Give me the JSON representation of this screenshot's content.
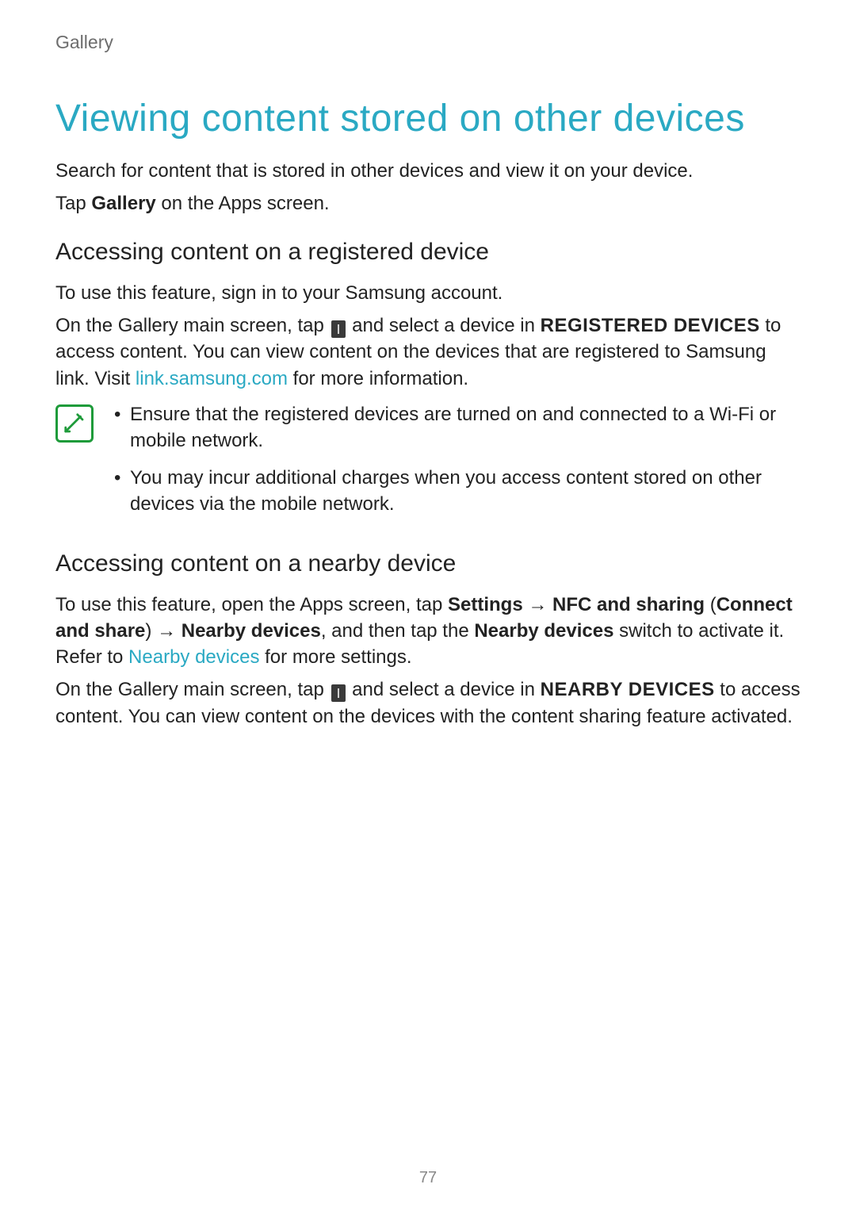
{
  "breadcrumb": "Gallery",
  "heading": "Viewing content stored on other devices",
  "intro1": "Search for content that is stored in other devices and view it on your device.",
  "intro2_pre": "Tap ",
  "intro2_bold": "Gallery",
  "intro2_post": " on the Apps screen.",
  "section1": {
    "heading": "Accessing content on a registered device",
    "p1": "To use this feature, sign in to your Samsung account.",
    "p2_a": "On the Gallery main screen, tap ",
    "p2_b": " and select a device in ",
    "p2_bold": "REGISTERED DEVICES",
    "p2_c": " to access content. You can view content on the devices that are registered to Samsung link. Visit ",
    "p2_link": "link.samsung.com",
    "p2_d": " for more information.",
    "notes": [
      "Ensure that the registered devices are turned on and connected to a Wi-Fi or mobile network.",
      "You may incur additional charges when you access content stored on other devices via the mobile network."
    ]
  },
  "section2": {
    "heading": "Accessing content on a nearby device",
    "p1_a": "To use this feature, open the Apps screen, tap ",
    "p1_b1": "Settings",
    "p1_arrow": " → ",
    "p1_b2": "NFC and sharing",
    "p1_paren_open": " (",
    "p1_b3": "Connect and share",
    "p1_paren_close": ") ",
    "p1_arrow2": "→ ",
    "p1_b4": "Nearby devices",
    "p1_c": ", and then tap the ",
    "p1_b5": "Nearby devices",
    "p1_d": " switch to activate it. Refer to ",
    "p1_link": "Nearby devices",
    "p1_e": " for more settings.",
    "p2_a": "On the Gallery main screen, tap ",
    "p2_b": " and select a device in ",
    "p2_bold": "NEARBY DEVICES",
    "p2_c": " to access content. You can view content on the devices with the content sharing feature activated."
  },
  "page_number": "77",
  "icons": {
    "menu": "menu-icon",
    "note": "note-icon"
  }
}
